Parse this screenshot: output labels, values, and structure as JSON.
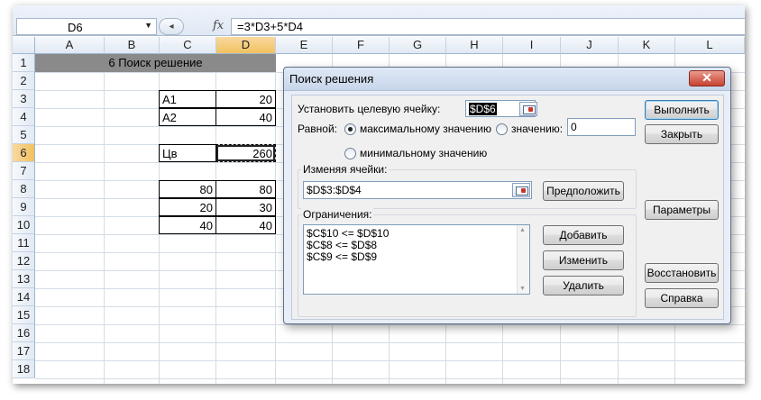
{
  "formula_bar": {
    "name_box": "D6",
    "fx_label": "fx",
    "formula": "=3*D3+5*D4"
  },
  "columns": [
    "A",
    "B",
    "C",
    "D",
    "E",
    "F",
    "G",
    "H",
    "I",
    "J",
    "K",
    "L"
  ],
  "rows": [
    "1",
    "2",
    "3",
    "4",
    "5",
    "6",
    "7",
    "8",
    "9",
    "10",
    "11",
    "12",
    "13",
    "14",
    "15",
    "16",
    "17",
    "18"
  ],
  "cells": {
    "title": "6 Поиск решение",
    "C3": "A1",
    "D3": "20",
    "C4": "A2",
    "D4": "40",
    "C6": "Цв",
    "D6": "260",
    "C8": "80",
    "D8": "80",
    "C9": "20",
    "D9": "30",
    "C10": "40",
    "D10": "40"
  },
  "dialog": {
    "title": "Поиск решения",
    "close": "✕",
    "target_label": "Установить целевую ячейку:",
    "target_value": "$D$6",
    "equal_label": "Равной:",
    "radio_max": "максимальному значению",
    "radio_value": "значению:",
    "value_input": "0",
    "radio_min": "минимальному значению",
    "changing_label": "Изменяя ячейки:",
    "changing_value": "$D$3:$D$4",
    "guess_button": "Предположить",
    "constraints_label": "Ограничения:",
    "constraints": [
      "$C$10 <= $D$10",
      "$C$8 <= $D$8",
      "$C$9 <= $D$9"
    ],
    "add_button": "Добавить",
    "change_button": "Изменить",
    "delete_button": "Удалить",
    "solve_button": "Выполнить",
    "close_button": "Закрыть",
    "options_button": "Параметры",
    "reset_button": "Восстановить",
    "help_button": "Справка"
  }
}
